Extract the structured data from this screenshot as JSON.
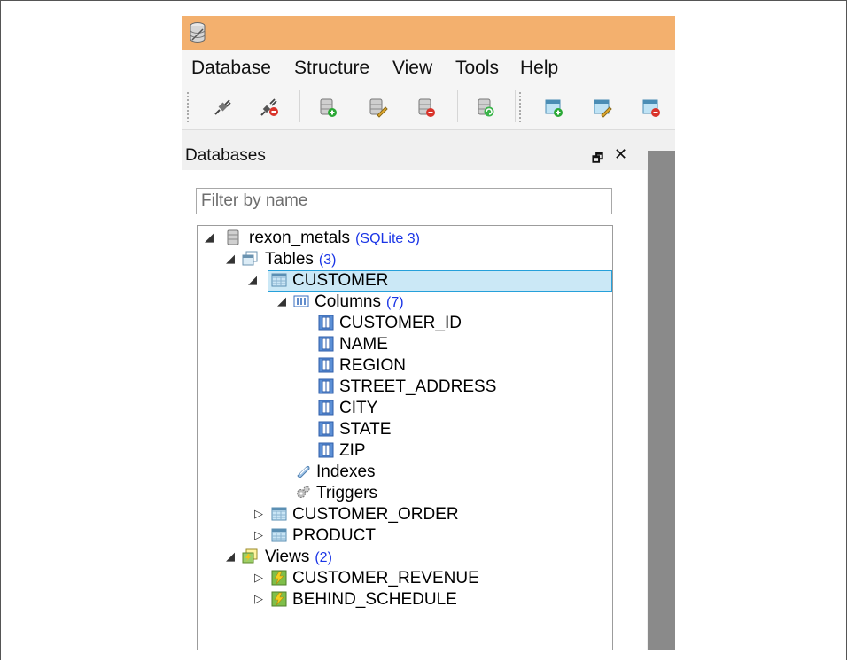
{
  "window": {
    "title": ""
  },
  "menu": [
    "Database",
    "Structure",
    "View",
    "Tools",
    "Help"
  ],
  "toolbar": {
    "buttons": [
      "connect-icon",
      "disconnect-icon",
      "add-database-icon",
      "edit-database-icon",
      "remove-database-icon",
      "refresh-icon",
      "add-table-icon",
      "edit-table-icon",
      "remove-table-icon"
    ]
  },
  "databases_panel": {
    "title": "Databases",
    "float_glyph": "🗗",
    "close_glyph": "✕",
    "filter_placeholder": "Filter by name",
    "tree": {
      "database": {
        "name": "rexon_metals",
        "detail": "(SQLite 3)"
      },
      "tables": {
        "label": "Tables",
        "count": "(3)"
      },
      "customer": {
        "name": "CUSTOMER"
      },
      "columns": {
        "label": "Columns",
        "count": "(7)",
        "items": [
          "CUSTOMER_ID",
          "NAME",
          "REGION",
          "STREET_ADDRESS",
          "CITY",
          "STATE",
          "ZIP"
        ]
      },
      "indexes": "Indexes",
      "triggers": "Triggers",
      "other_tables": [
        "CUSTOMER_ORDER",
        "PRODUCT"
      ],
      "views": {
        "label": "Views",
        "count": "(2)",
        "items": [
          "CUSTOMER_REVENUE",
          "BEHIND_SCHEDULE"
        ]
      }
    }
  },
  "colors": {
    "titlebar": "#f3b06e",
    "selection": "#cbe8f6",
    "selection_border": "#26a0da",
    "count_text": "#1a35e6"
  }
}
